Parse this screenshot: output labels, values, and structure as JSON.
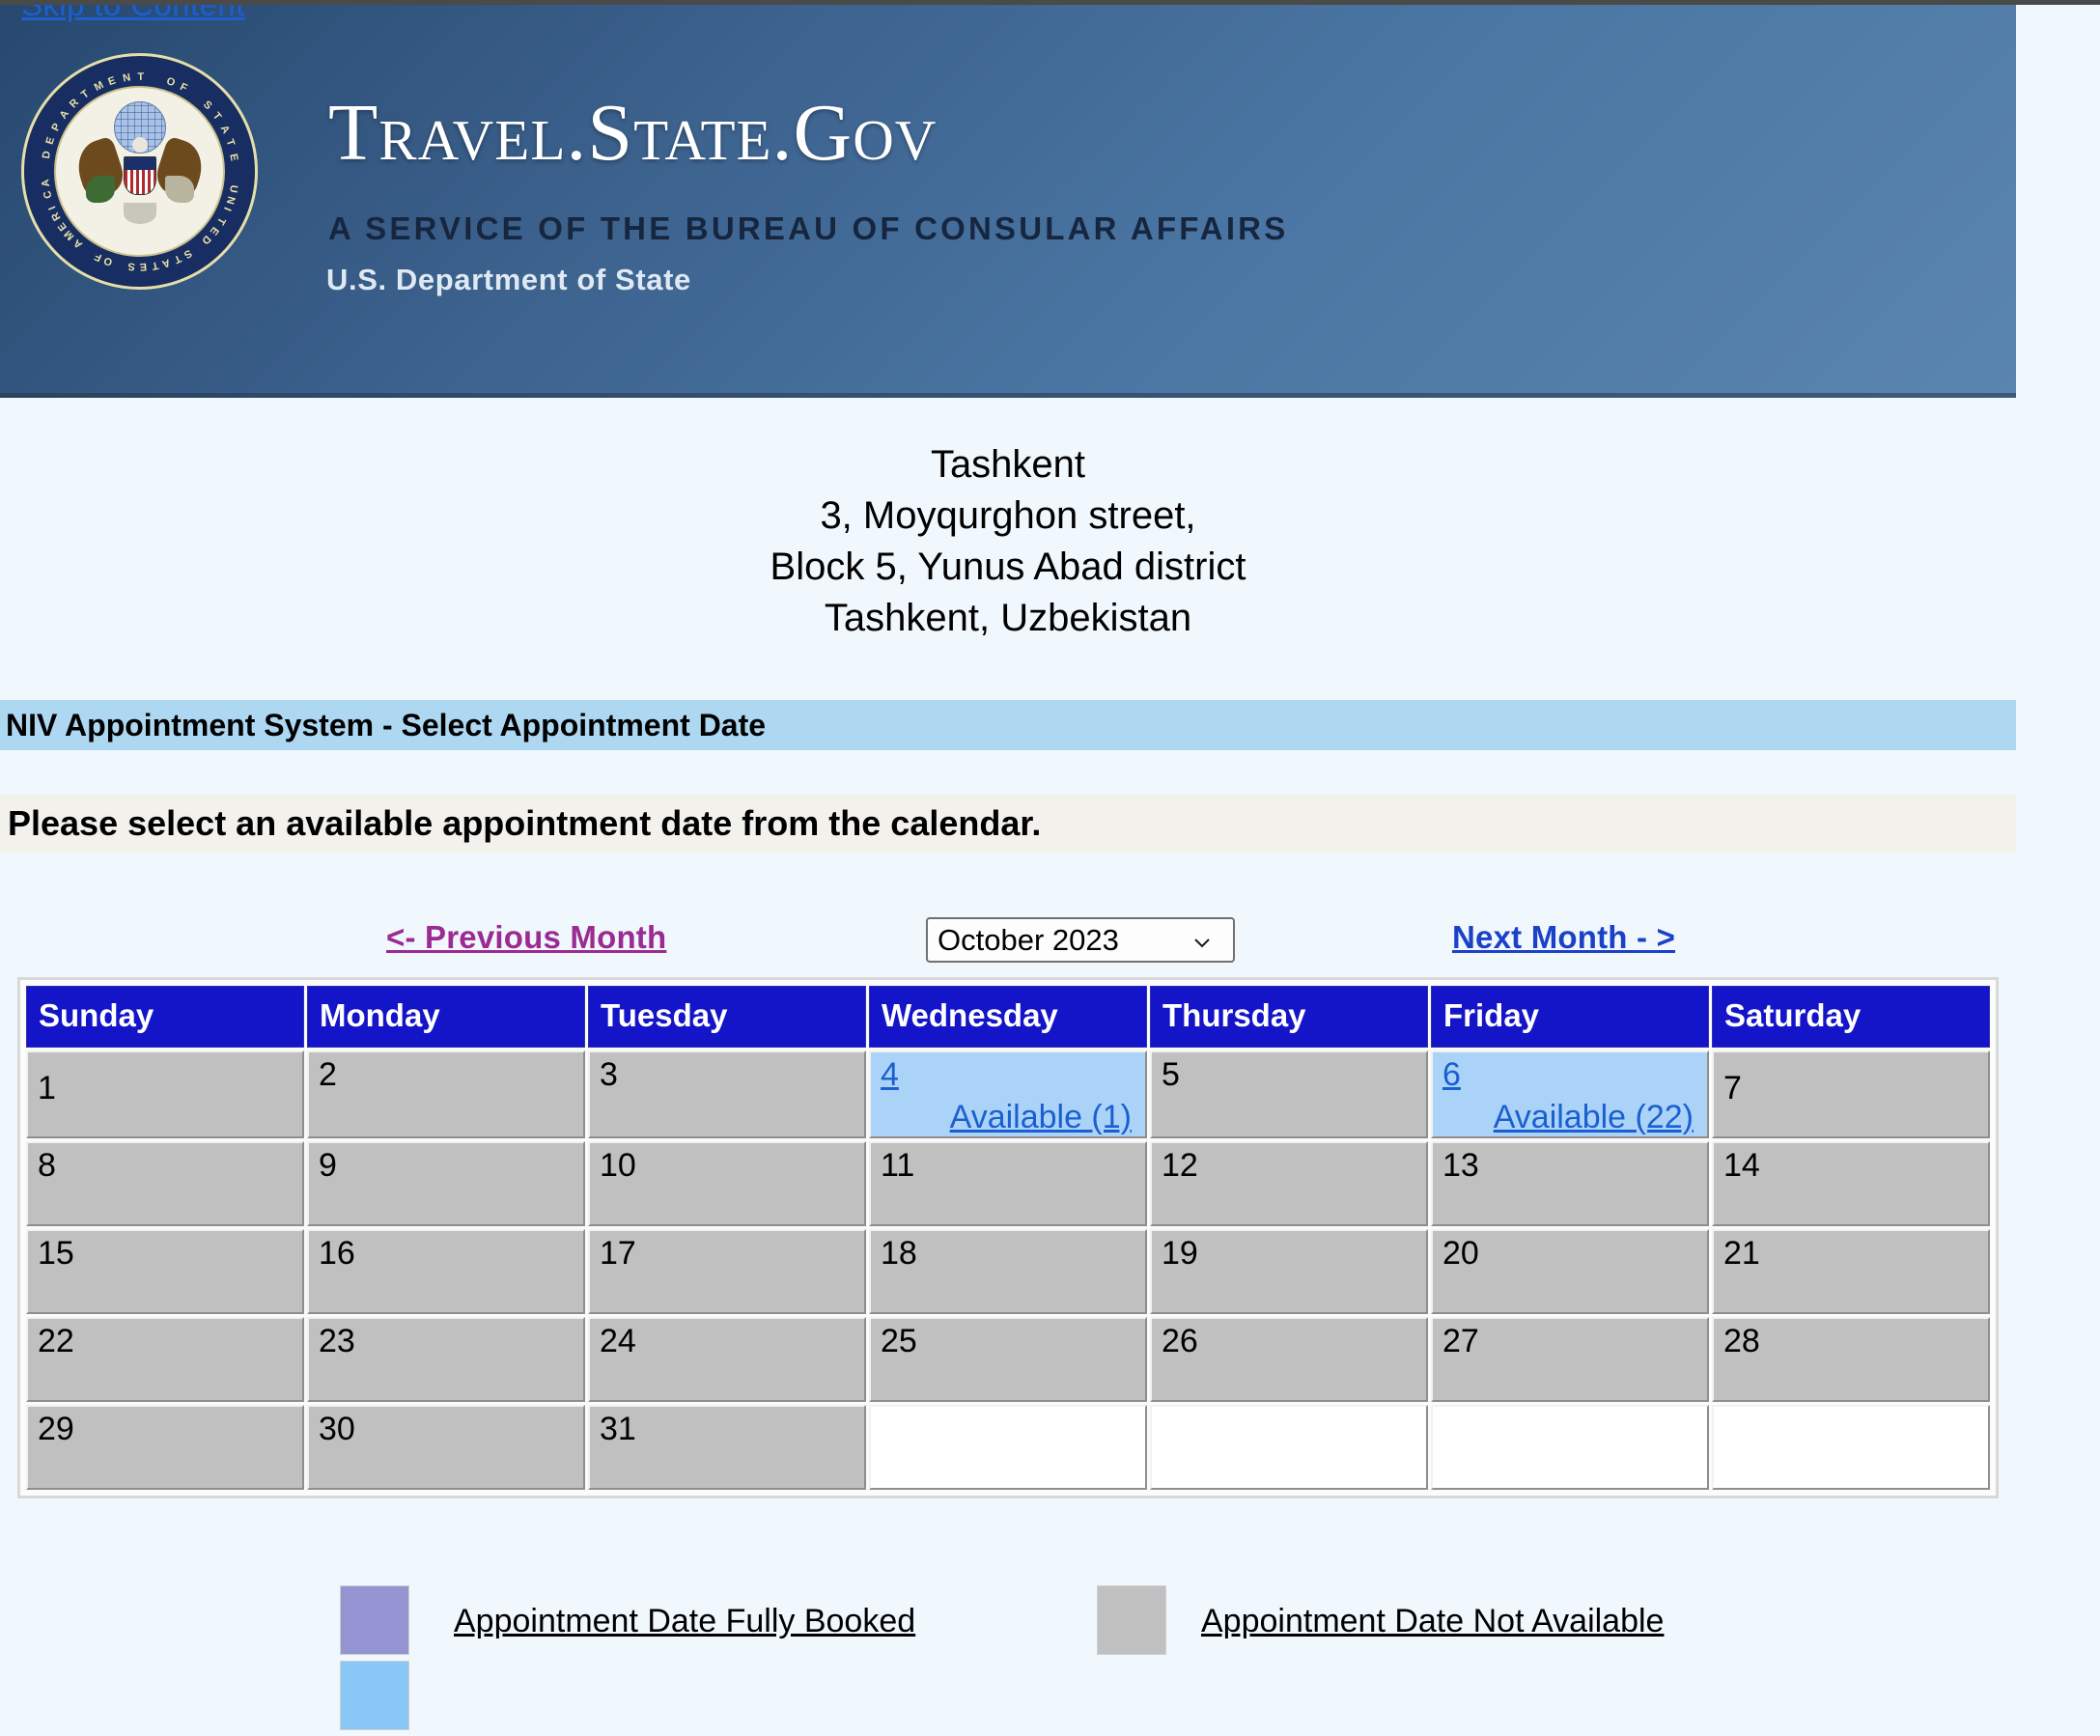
{
  "accessibility": {
    "skip_link": "Skip to Content"
  },
  "banner": {
    "seal_alt": "department-of-state-seal",
    "title": "Travel.State.Gov",
    "subtitle": "A SERVICE OF THE BUREAU OF CONSULAR AFFAIRS",
    "agency": "U.S. Department of State",
    "seal_ring_top": "DEPARTMENT OF STATE",
    "seal_ring_bottom": "UNITED STATES OF AMERICA"
  },
  "post": {
    "lines": [
      "Tashkent",
      "3, Moyqurghon street,",
      "Block 5, Yunus Abad district",
      "Tashkent, Uzbekistan"
    ]
  },
  "section": {
    "title": "NIV Appointment System - Select Appointment Date",
    "instruction": "Please select an available appointment date from the calendar."
  },
  "nav": {
    "previous_month": "<- Previous Month",
    "next_month": "Next Month - >",
    "month_selected": "October  2023",
    "month_options": [
      "October  2023"
    ]
  },
  "calendar": {
    "weekday_headers": [
      "Sunday",
      "Monday",
      "Tuesday",
      "Wednesday",
      "Thursday",
      "Friday",
      "Saturday"
    ],
    "weeks": [
      [
        {
          "day": "1",
          "state": "unavailable",
          "available_text": "",
          "nudge": true
        },
        {
          "day": "2",
          "state": "unavailable",
          "available_text": "",
          "nudge": false
        },
        {
          "day": "3",
          "state": "unavailable",
          "available_text": "",
          "nudge": false
        },
        {
          "day": "4",
          "state": "available",
          "available_text": "Available (1)",
          "nudge": false
        },
        {
          "day": "5",
          "state": "unavailable",
          "available_text": "",
          "nudge": false
        },
        {
          "day": "6",
          "state": "available",
          "available_text": "Available (22)",
          "nudge": false
        },
        {
          "day": "7",
          "state": "unavailable",
          "available_text": "",
          "nudge": true
        }
      ],
      [
        {
          "day": "8",
          "state": "unavailable",
          "available_text": "",
          "nudge": false
        },
        {
          "day": "9",
          "state": "unavailable",
          "available_text": "",
          "nudge": false
        },
        {
          "day": "10",
          "state": "unavailable",
          "available_text": "",
          "nudge": false
        },
        {
          "day": "11",
          "state": "unavailable",
          "available_text": "",
          "nudge": false
        },
        {
          "day": "12",
          "state": "unavailable",
          "available_text": "",
          "nudge": false
        },
        {
          "day": "13",
          "state": "unavailable",
          "available_text": "",
          "nudge": false
        },
        {
          "day": "14",
          "state": "unavailable",
          "available_text": "",
          "nudge": false
        }
      ],
      [
        {
          "day": "15",
          "state": "unavailable",
          "available_text": "",
          "nudge": false
        },
        {
          "day": "16",
          "state": "unavailable",
          "available_text": "",
          "nudge": false
        },
        {
          "day": "17",
          "state": "unavailable",
          "available_text": "",
          "nudge": false
        },
        {
          "day": "18",
          "state": "unavailable",
          "available_text": "",
          "nudge": false
        },
        {
          "day": "19",
          "state": "unavailable",
          "available_text": "",
          "nudge": false
        },
        {
          "day": "20",
          "state": "unavailable",
          "available_text": "",
          "nudge": false
        },
        {
          "day": "21",
          "state": "unavailable",
          "available_text": "",
          "nudge": false
        }
      ],
      [
        {
          "day": "22",
          "state": "unavailable",
          "available_text": "",
          "nudge": false
        },
        {
          "day": "23",
          "state": "unavailable",
          "available_text": "",
          "nudge": false
        },
        {
          "day": "24",
          "state": "unavailable",
          "available_text": "",
          "nudge": false
        },
        {
          "day": "25",
          "state": "unavailable",
          "available_text": "",
          "nudge": false
        },
        {
          "day": "26",
          "state": "unavailable",
          "available_text": "",
          "nudge": false
        },
        {
          "day": "27",
          "state": "unavailable",
          "available_text": "",
          "nudge": false
        },
        {
          "day": "28",
          "state": "unavailable",
          "available_text": "",
          "nudge": false
        }
      ],
      [
        {
          "day": "29",
          "state": "unavailable",
          "available_text": "",
          "nudge": false
        },
        {
          "day": "30",
          "state": "unavailable",
          "available_text": "",
          "nudge": false
        },
        {
          "day": "31",
          "state": "unavailable",
          "available_text": "",
          "nudge": false
        },
        {
          "day": "",
          "state": "empty",
          "available_text": "",
          "nudge": false
        },
        {
          "day": "",
          "state": "empty",
          "available_text": "",
          "nudge": false
        },
        {
          "day": "",
          "state": "empty",
          "available_text": "",
          "nudge": false
        },
        {
          "day": "",
          "state": "empty",
          "available_text": "",
          "nudge": false
        }
      ]
    ]
  },
  "legend": {
    "fully_booked_label": "Appointment Date Fully Booked",
    "not_available_label": "Appointment Date Not Available"
  },
  "colors": {
    "header_blue": "#1414c8",
    "available_bg": "#abd3f8",
    "unavailable_bg": "#c0c0c0",
    "fully_booked_swatch": "#9494d2",
    "section_bar": "#aed8f2",
    "link_blue": "#1b5fd0",
    "visited_link": "#9b2b92",
    "page_bg": "#f0f7fd"
  }
}
